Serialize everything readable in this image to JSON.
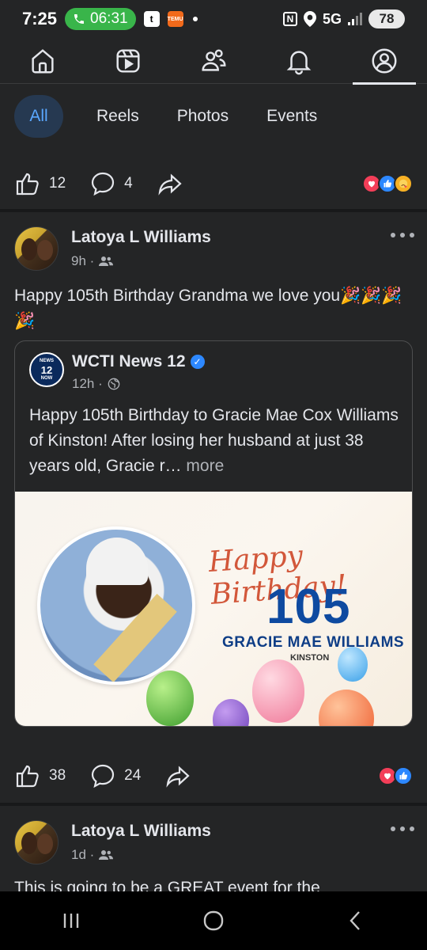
{
  "status_bar": {
    "time": "7:25",
    "call_timer": "06:31",
    "network": "5G",
    "battery": "78"
  },
  "top_nav": {
    "items": [
      {
        "name": "home-icon"
      },
      {
        "name": "video-icon"
      },
      {
        "name": "friends-icon"
      },
      {
        "name": "bell-icon"
      },
      {
        "name": "profile-icon",
        "active": true
      }
    ]
  },
  "filters": {
    "tabs": [
      {
        "label": "All",
        "active": true
      },
      {
        "label": "Reels"
      },
      {
        "label": "Photos"
      },
      {
        "label": "Events"
      }
    ]
  },
  "prev_post_actions": {
    "likes": "12",
    "comments": "4"
  },
  "post1": {
    "author": "Latoya L Williams",
    "time": "9h ·",
    "text": "Happy 105th Birthday Grandma we love you🎉🎉🎉🎉",
    "shared": {
      "page_name": "WCTI News 12",
      "logo_top": "NEWS",
      "logo_mid": "12",
      "logo_bot": "NOW",
      "time": "12h ·",
      "text": "Happy 105th Birthday to Gracie Mae Cox Williams of Kinston! After losing her husband at just 38 years old, Gracie r…",
      "more": " more",
      "image": {
        "greeting": "Happy Birthday!",
        "age": "105",
        "name": "GRACIE MAE WILLIAMS",
        "city": "KINSTON"
      }
    },
    "likes": "38",
    "comments": "24"
  },
  "post2": {
    "author": "Latoya L Williams",
    "time": "1d ·",
    "text": "This is going to be a GREAT event for the"
  },
  "colors": {
    "background": "#242526",
    "accent": "#5aa7ff",
    "active_chip": "#263951",
    "text": "#e4e6eb",
    "muted": "#b0b3b8"
  }
}
